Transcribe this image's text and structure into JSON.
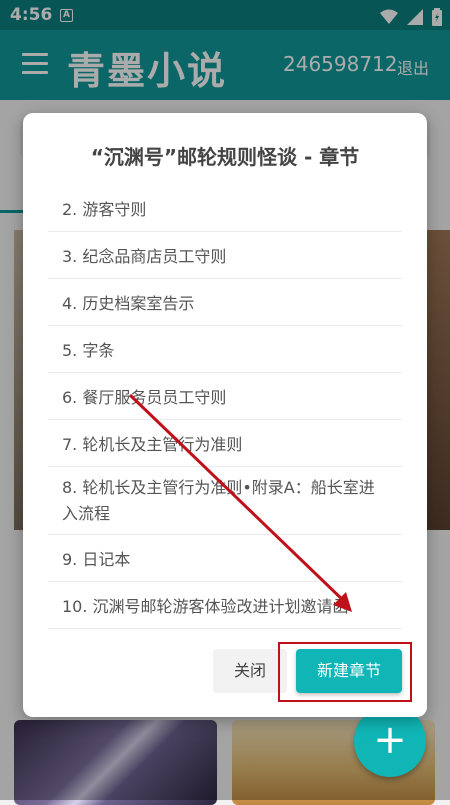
{
  "status": {
    "time": "4:56",
    "indicator": "A"
  },
  "appbar": {
    "title": "青墨小说",
    "user_id": "246598712",
    "logout_label": "退出"
  },
  "dialog": {
    "title": "“沉渊号”邮轮规则怪谈 - 章节",
    "chapters": [
      "2. 游客守则",
      "3. 纪念品商店员工守则",
      "4. 历史档案室告示",
      "5. 字条",
      "6. 餐厅服务员员工守则",
      "7. 轮机长及主管行为准则",
      "8. 轮机长及主管行为准则•附录A：船长室进入流程",
      "9. 日记本",
      "10. 沉渊号邮轮游客体验改进计划邀请函"
    ],
    "close_label": "关闭",
    "new_chapter_label": "新建章节"
  },
  "fab_label": "+",
  "colors": {
    "primary": "#10999a",
    "accent": "#10b6b6",
    "annotation": "#c0101a"
  },
  "icons": [
    "menu-icon",
    "wifi-icon",
    "signal-icon",
    "battery-icon",
    "add-icon"
  ]
}
